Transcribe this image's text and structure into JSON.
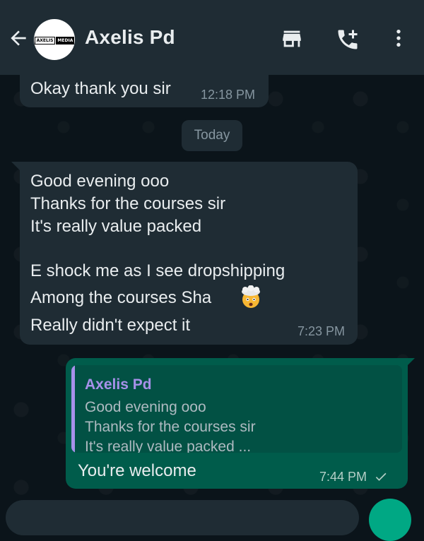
{
  "header": {
    "contact_name": "Axelis Pd",
    "avatar_logo": [
      "AXELIS",
      "MEDIA"
    ],
    "icons": [
      "back-arrow-icon",
      "store-icon",
      "add-call-icon",
      "more-vert-icon"
    ]
  },
  "messages": [
    {
      "text": "Okay thank you sir",
      "time": "12:18 PM",
      "direction": "incoming"
    },
    {
      "date_separator": "Today"
    },
    {
      "lines": [
        "Good evening ooo",
        "Thanks for the courses sir",
        "It's really value packed",
        "",
        "E shock me as I see dropshipping",
        "Among the courses Sha",
        "Really didn't expect it"
      ],
      "emoji": "exploding-head-emoji",
      "time": "7:23 PM",
      "direction": "incoming"
    },
    {
      "reply_to": {
        "author": "Axelis Pd",
        "lines": [
          "Good evening ooo",
          "Thanks for the courses sir",
          "It's really value packed ..."
        ]
      },
      "text": "You're welcome",
      "time": "7:44 PM",
      "status": "sent",
      "direction": "outgoing"
    }
  ],
  "colors": {
    "header_bg": "#1f2c34",
    "chat_bg": "#0b141a",
    "outgoing": "#005c4b",
    "accent": "#00a884",
    "quote_author": "#a791ea"
  }
}
